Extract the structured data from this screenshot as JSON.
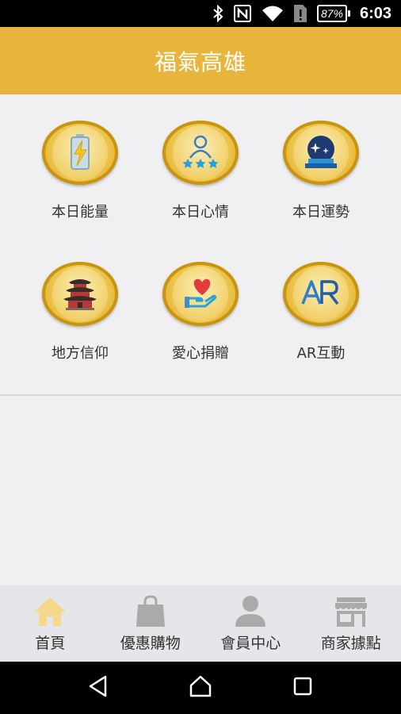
{
  "status_bar": {
    "battery_percent": "87%",
    "time": "6:03",
    "icons": [
      "bluetooth-icon",
      "nfc-icon",
      "wifi-icon",
      "sim-alert-icon",
      "battery-icon"
    ]
  },
  "header": {
    "title": "福氣高雄"
  },
  "colors": {
    "header_bg": "#e8b53c",
    "coin_gold": "#ecc34c",
    "nav_active": "#f5d88a",
    "nav_inactive": "#aaaaaa",
    "background": "#f0f0f2"
  },
  "tiles": [
    {
      "label": "本日能量",
      "icon": "battery-energy-icon"
    },
    {
      "label": "本日心情",
      "icon": "mood-stars-icon"
    },
    {
      "label": "本日運勢",
      "icon": "crystal-ball-icon"
    },
    {
      "label": "地方信仰",
      "icon": "temple-icon"
    },
    {
      "label": "愛心捐贈",
      "icon": "heart-hand-icon"
    },
    {
      "label": "AR互動",
      "icon": "ar-icon"
    }
  ],
  "bottom_nav": [
    {
      "label": "首頁",
      "icon": "home-icon",
      "active": true
    },
    {
      "label": "優惠購物",
      "icon": "shopping-bag-icon",
      "active": false
    },
    {
      "label": "會員中心",
      "icon": "user-icon",
      "active": false
    },
    {
      "label": "商家據點",
      "icon": "store-icon",
      "active": false
    }
  ],
  "system_nav": [
    "back-icon",
    "home-circle-icon",
    "recents-icon"
  ]
}
